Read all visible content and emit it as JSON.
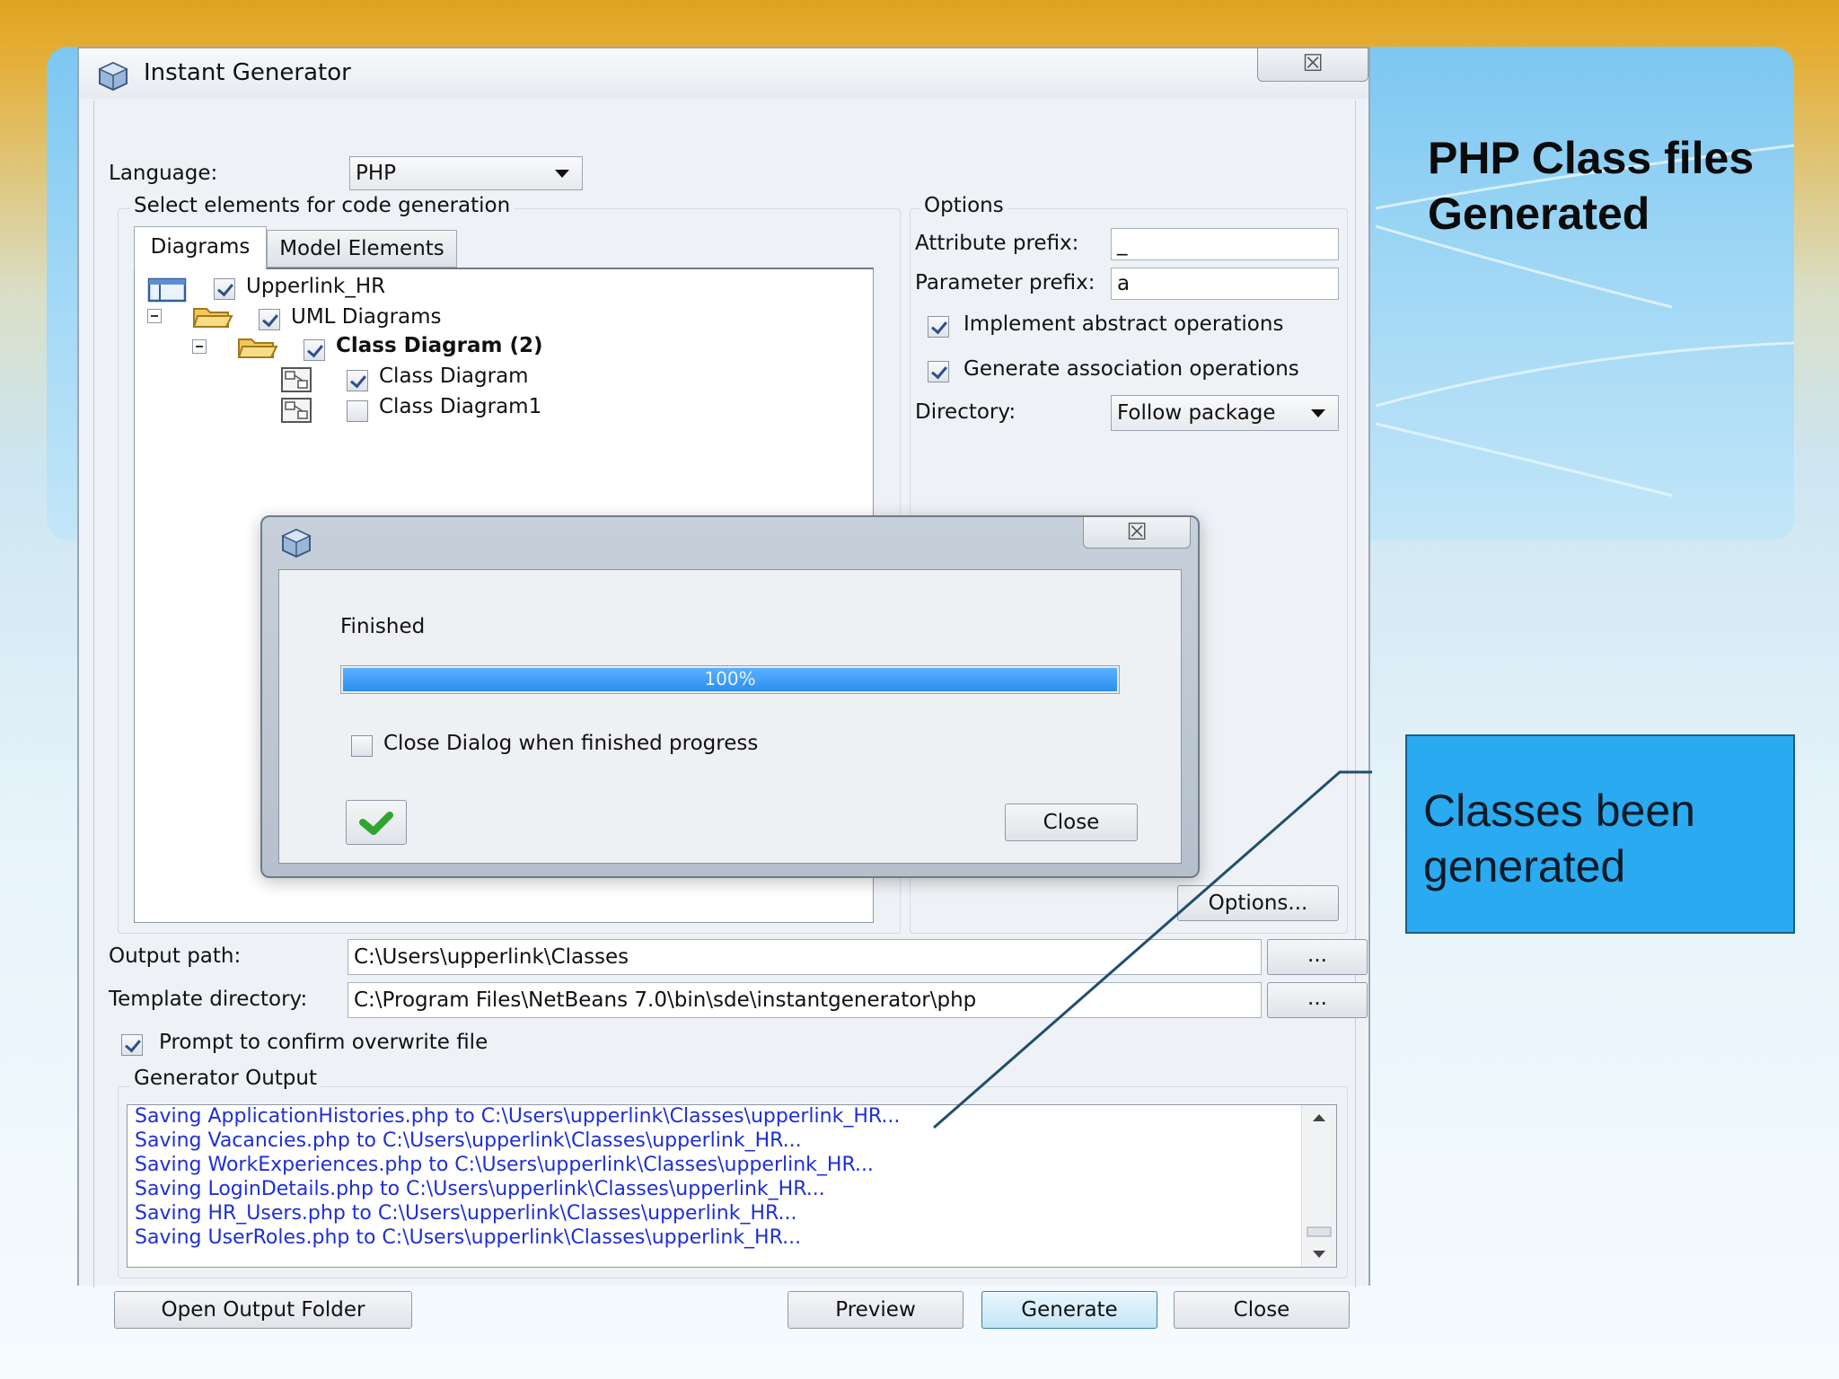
{
  "slide": {
    "title_line1": "PHP Class files",
    "title_line2": "Generated",
    "callout_line1": "Classes been",
    "callout_line2": "generated"
  },
  "window": {
    "title": "Instant Generator",
    "close_glyph": "☒",
    "language_label": "Language:",
    "language_value": "PHP",
    "select_group_label": "Select elements for code generation",
    "tabs": [
      "Diagrams",
      "Model Elements"
    ],
    "tree": [
      {
        "label": "Upperlink_HR",
        "checked": true
      },
      {
        "label": "UML Diagrams",
        "checked": true
      },
      {
        "label": "Class Diagram (2)",
        "checked": true
      },
      {
        "label": "Class Diagram",
        "checked": true
      },
      {
        "label": "Class Diagram1",
        "checked": false
      }
    ],
    "options": {
      "group_label": "Options",
      "attribute_prefix_label": "Attribute prefix:",
      "attribute_prefix_value": "_",
      "parameter_prefix_label": "Parameter prefix:",
      "parameter_prefix_value": "a",
      "implement_abstract_label": "Implement abstract operations",
      "implement_abstract_checked": true,
      "generate_association_label": "Generate association operations",
      "generate_association_checked": true,
      "directory_label": "Directory:",
      "directory_value": "Follow package",
      "options_button": "Options..."
    },
    "output_path_label": "Output path:",
    "output_path_value": "C:\\Users\\upperlink\\Classes",
    "template_dir_label": "Template directory:",
    "template_dir_value": "C:\\Program Files\\NetBeans 7.0\\bin\\sde\\instantgenerator\\php",
    "browse_label": "...",
    "prompt_overwrite_label": "Prompt to confirm overwrite file",
    "prompt_overwrite_checked": true,
    "generator_output_label": "Generator Output",
    "output_lines": [
      "Saving ApplicationHistories.php to C:\\Users\\upperlink\\Classes\\upperlink_HR...",
      "Saving Vacancies.php to C:\\Users\\upperlink\\Classes\\upperlink_HR...",
      "Saving WorkExperiences.php to C:\\Users\\upperlink\\Classes\\upperlink_HR...",
      "Saving LoginDetails.php to C:\\Users\\upperlink\\Classes\\upperlink_HR...",
      "Saving HR_Users.php to C:\\Users\\upperlink\\Classes\\upperlink_HR...",
      "Saving UserRoles.php to C:\\Users\\upperlink\\Classes\\upperlink_HR..."
    ],
    "buttons": {
      "open_output_folder": "Open Output Folder",
      "preview": "Preview",
      "generate": "Generate",
      "close": "Close"
    }
  },
  "progress_dialog": {
    "status": "Finished",
    "progress_fraction": 1.0,
    "progress_text": "100%",
    "close_when_finished_label": "Close Dialog when finished progress",
    "close_when_finished_checked": false,
    "close_button": "Close",
    "close_glyph": "☒"
  },
  "colors": {
    "output_text": "#1e2fd6",
    "progress_fill": "#2b8ef0",
    "callout_bg": "#2aaaf0"
  }
}
